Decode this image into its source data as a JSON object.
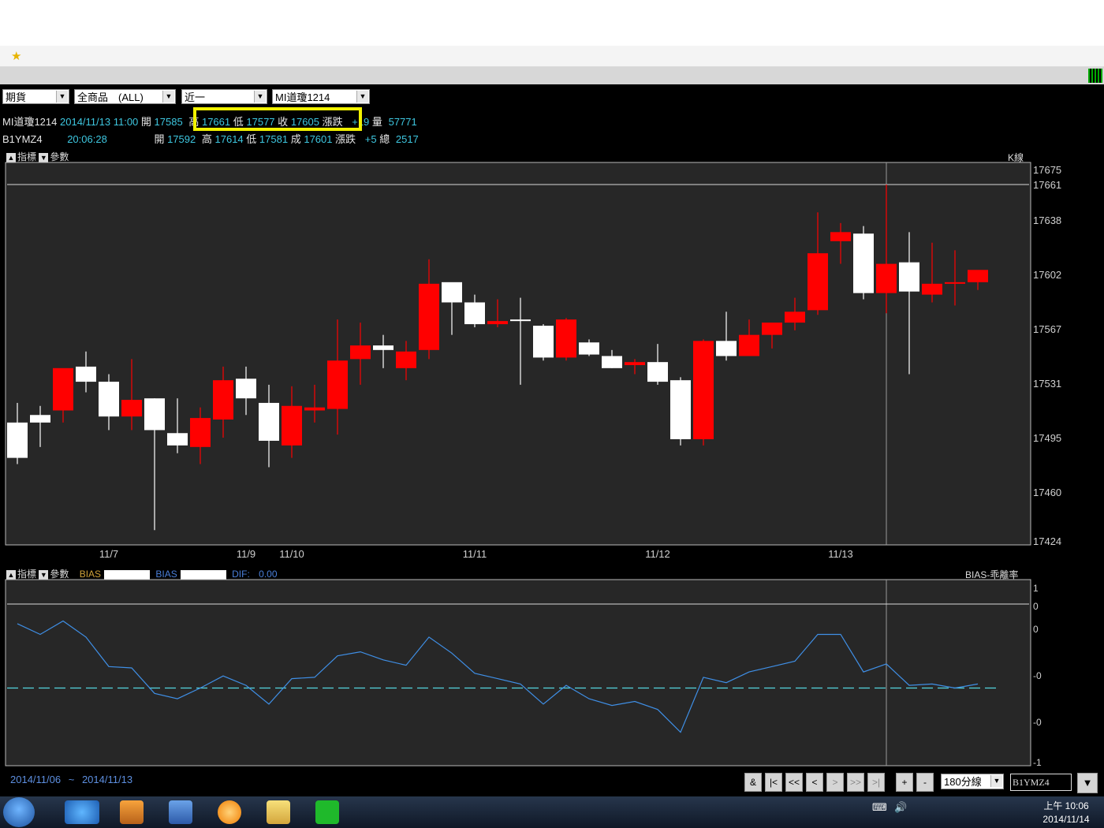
{
  "toolbar": {
    "selects": [
      "期貨",
      "全商品　(ALL)",
      "近一",
      "MI道瓊1214"
    ]
  },
  "quote_row1": {
    "name": "MI道瓊1214",
    "datetime": "2014/11/13 11:00",
    "open_label": "開",
    "open": "17585",
    "high_label": "高",
    "high": "17661",
    "low_label": "低",
    "low": "17577",
    "close_label": "收",
    "close": "17605",
    "change_label": "漲跌",
    "change": "+19",
    "volume_label": "量",
    "volume": "57771"
  },
  "quote_row2": {
    "name": "B1YMZ4",
    "time": "20:06:28",
    "open_label": "開",
    "open": "17592",
    "high_label": "高",
    "high": "17614",
    "low_label": "低",
    "low": "17581",
    "close_label": "成",
    "close": "17601",
    "change_label": "漲跌",
    "change": "+5",
    "volume_label": "總",
    "volume": "2517"
  },
  "price_panel": {
    "btn1": "指標",
    "btn2": "參數",
    "corner": "K線"
  },
  "bias_panel": {
    "btn1": "指標",
    "btn2": "參數",
    "label1": "BIAS",
    "label2": "BIAS",
    "dif_label": "DIF:",
    "dif_value": "0.00",
    "corner": "BIAS-乖離率"
  },
  "chart_data": [
    {
      "type": "candlestick",
      "title": "",
      "y_ticks": [
        17675,
        17661,
        17638,
        17602,
        17567,
        17531,
        17495,
        17460,
        17424
      ],
      "ylim": [
        17424,
        17675
      ],
      "reference_line": 17661,
      "x_labels": [
        {
          "index": 4,
          "label": "11/7"
        },
        {
          "index": 10,
          "label": "11/9"
        },
        {
          "index": 12,
          "label": "11/10"
        },
        {
          "index": 20,
          "label": "11/11"
        },
        {
          "index": 28,
          "label": "11/12"
        },
        {
          "index": 36,
          "label": "11/13"
        }
      ],
      "candles": [
        {
          "o": 17505,
          "h": 17518,
          "l": 17478,
          "c": 17482
        },
        {
          "o": 17510,
          "h": 17516,
          "l": 17489,
          "c": 17505
        },
        {
          "o": 17513,
          "h": 17540,
          "l": 17505,
          "c": 17541
        },
        {
          "o": 17542,
          "h": 17552,
          "l": 17525,
          "c": 17532
        },
        {
          "o": 17532,
          "h": 17537,
          "l": 17500,
          "c": 17509
        },
        {
          "o": 17509,
          "h": 17547,
          "l": 17500,
          "c": 17520
        },
        {
          "o": 17521,
          "h": 17521,
          "l": 17432,
          "c": 17500
        },
        {
          "o": 17498,
          "h": 17521,
          "l": 17485,
          "c": 17490
        },
        {
          "o": 17489,
          "h": 17515,
          "l": 17478,
          "c": 17508
        },
        {
          "o": 17507,
          "h": 17542,
          "l": 17495,
          "c": 17533
        },
        {
          "o": 17534,
          "h": 17542,
          "l": 17510,
          "c": 17521
        },
        {
          "o": 17518,
          "h": 17530,
          "l": 17476,
          "c": 17493
        },
        {
          "o": 17490,
          "h": 17529,
          "l": 17482,
          "c": 17516
        },
        {
          "o": 17513,
          "h": 17530,
          "l": 17505,
          "c": 17515
        },
        {
          "o": 17514,
          "h": 17573,
          "l": 17497,
          "c": 17546
        },
        {
          "o": 17547,
          "h": 17571,
          "l": 17530,
          "c": 17556
        },
        {
          "o": 17556,
          "h": 17563,
          "l": 17541,
          "c": 17553
        },
        {
          "o": 17541,
          "h": 17559,
          "l": 17533,
          "c": 17552
        },
        {
          "o": 17553,
          "h": 17612,
          "l": 17547,
          "c": 17596
        },
        {
          "o": 17597,
          "h": 17596,
          "l": 17563,
          "c": 17584
        },
        {
          "o": 17584,
          "h": 17589,
          "l": 17568,
          "c": 17570
        },
        {
          "o": 17570,
          "h": 17586,
          "l": 17568,
          "c": 17572
        },
        {
          "o": 17573,
          "h": 17587,
          "l": 17530,
          "c": 17572
        },
        {
          "o": 17569,
          "h": 17570,
          "l": 17546,
          "c": 17548
        },
        {
          "o": 17548,
          "h": 17574,
          "l": 17546,
          "c": 17573
        },
        {
          "o": 17558,
          "h": 17560,
          "l": 17549,
          "c": 17550
        },
        {
          "o": 17549,
          "h": 17553,
          "l": 17541,
          "c": 17541
        },
        {
          "o": 17543,
          "h": 17547,
          "l": 17537,
          "c": 17545
        },
        {
          "o": 17545,
          "h": 17557,
          "l": 17530,
          "c": 17532
        },
        {
          "o": 17533,
          "h": 17535,
          "l": 17490,
          "c": 17494
        },
        {
          "o": 17494,
          "h": 17560,
          "l": 17490,
          "c": 17559
        },
        {
          "o": 17559,
          "h": 17578,
          "l": 17546,
          "c": 17549
        },
        {
          "o": 17549,
          "h": 17573,
          "l": 17549,
          "c": 17563
        },
        {
          "o": 17563,
          "h": 17570,
          "l": 17554,
          "c": 17571
        },
        {
          "o": 17571,
          "h": 17587,
          "l": 17566,
          "c": 17578
        },
        {
          "o": 17579,
          "h": 17643,
          "l": 17576,
          "c": 17616
        },
        {
          "o": 17624,
          "h": 17636,
          "l": 17609,
          "c": 17630
        },
        {
          "o": 17629,
          "h": 17634,
          "l": 17586,
          "c": 17590
        },
        {
          "o": 17590,
          "h": 17661,
          "l": 17577,
          "c": 17609
        },
        {
          "o": 17610,
          "h": 17630,
          "l": 17537,
          "c": 17591
        },
        {
          "o": 17589,
          "h": 17623,
          "l": 17584,
          "c": 17596
        },
        {
          "o": 17596,
          "h": 17618,
          "l": 17582,
          "c": 17597
        },
        {
          "o": 17597,
          "h": 17603,
          "l": 17592,
          "c": 17605
        }
      ]
    },
    {
      "type": "line",
      "title": "",
      "y_ticks": [
        "1",
        "0",
        "0",
        "-0",
        "-0",
        "-1"
      ],
      "baseline": 0,
      "values": [
        0.48,
        0.4,
        0.5,
        0.38,
        0.16,
        0.15,
        -0.04,
        -0.08,
        0.0,
        0.09,
        0.02,
        -0.12,
        0.07,
        0.08,
        0.24,
        0.27,
        0.21,
        0.17,
        0.38,
        0.26,
        0.11,
        0.07,
        0.03,
        -0.12,
        0.02,
        -0.08,
        -0.13,
        -0.1,
        -0.16,
        -0.33,
        0.08,
        0.04,
        0.12,
        0.16,
        0.2,
        0.4,
        0.4,
        0.12,
        0.18,
        0.02,
        0.03,
        0.0,
        0.03
      ]
    }
  ],
  "date_range": {
    "from": "2014/11/06",
    "sep": "~",
    "to": "2014/11/13"
  },
  "nav": {
    "buttons": [
      "&",
      "|<",
      "<<",
      "<",
      ">",
      ">>",
      ">|",
      "+",
      "-"
    ],
    "period": "180分線",
    "symbol": "B1YMZ4"
  },
  "clock": {
    "time": "上午 10:06",
    "date": "2014/11/14"
  },
  "colors": {
    "up": "#ff0000",
    "down": "#ffffff",
    "panel_bg": "#272727",
    "bias_line": "#3f8fe6",
    "zero_line": "#55d6e0"
  }
}
